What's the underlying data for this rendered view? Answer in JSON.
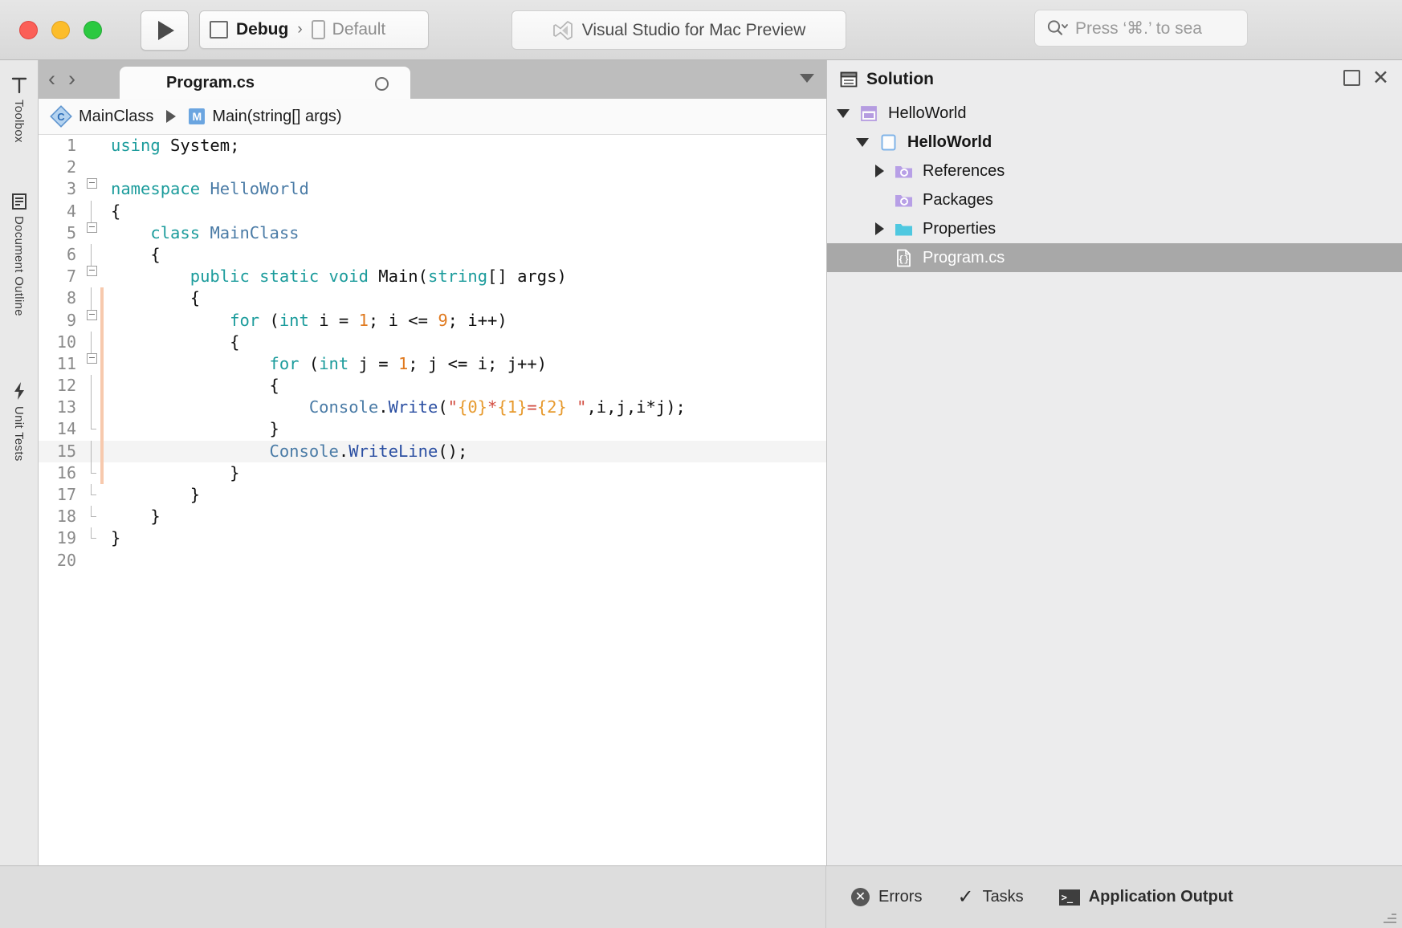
{
  "titlebar": {
    "window_controls": [
      "close",
      "minimize",
      "zoom"
    ],
    "run_button_icon": "play-icon",
    "configuration": "Debug",
    "config_separator": "›",
    "run_target": "Default",
    "app_title": "Visual Studio for Mac Preview",
    "app_logo_icon": "visual-studio-logo-icon",
    "search_placeholder": "Press ‘⌘.’ to sea"
  },
  "left_rail": {
    "items": [
      {
        "label": "Toolbox",
        "icon": "toolbox-icon"
      },
      {
        "label": "Document Outline",
        "icon": "document-outline-icon"
      },
      {
        "label": "Unit Tests",
        "icon": "unit-tests-icon"
      }
    ]
  },
  "editor": {
    "back_arrow": "‹",
    "forward_arrow": "›",
    "tab_title": "Program.cs",
    "breadcrumb": {
      "class_icon": "class-icon",
      "class_name": "MainClass",
      "method_icon_letter": "M",
      "method_name": "Main(string[] args)"
    },
    "total_lines": 20,
    "current_line": 15,
    "lines": [
      {
        "n": 1,
        "fold": "none",
        "change": false,
        "tokens": [
          {
            "c": "k",
            "t": "using"
          },
          {
            "c": "n",
            "t": " System;"
          }
        ]
      },
      {
        "n": 2,
        "fold": "none",
        "change": false,
        "tokens": []
      },
      {
        "n": 3,
        "fold": "open",
        "change": false,
        "tokens": [
          {
            "c": "k",
            "t": "namespace"
          },
          {
            "c": "n",
            "t": " "
          },
          {
            "c": "t",
            "t": "HelloWorld"
          }
        ]
      },
      {
        "n": 4,
        "fold": "line",
        "change": false,
        "tokens": [
          {
            "c": "n",
            "t": "{"
          }
        ]
      },
      {
        "n": 5,
        "fold": "open",
        "change": false,
        "tokens": [
          {
            "c": "n",
            "t": "    "
          },
          {
            "c": "k",
            "t": "class"
          },
          {
            "c": "n",
            "t": " "
          },
          {
            "c": "t",
            "t": "MainClass"
          }
        ]
      },
      {
        "n": 6,
        "fold": "line",
        "change": false,
        "tokens": [
          {
            "c": "n",
            "t": "    {"
          }
        ]
      },
      {
        "n": 7,
        "fold": "open",
        "change": false,
        "tokens": [
          {
            "c": "n",
            "t": "        "
          },
          {
            "c": "k",
            "t": "public static void"
          },
          {
            "c": "n",
            "t": " Main("
          },
          {
            "c": "k",
            "t": "string"
          },
          {
            "c": "n",
            "t": "[] args)"
          }
        ]
      },
      {
        "n": 8,
        "fold": "line",
        "change": true,
        "tokens": [
          {
            "c": "n",
            "t": "        {"
          }
        ]
      },
      {
        "n": 9,
        "fold": "open",
        "change": true,
        "tokens": [
          {
            "c": "n",
            "t": "            "
          },
          {
            "c": "k",
            "t": "for"
          },
          {
            "c": "n",
            "t": " ("
          },
          {
            "c": "k",
            "t": "int"
          },
          {
            "c": "n",
            "t": " i = "
          },
          {
            "c": "num",
            "t": "1"
          },
          {
            "c": "n",
            "t": "; i <= "
          },
          {
            "c": "num",
            "t": "9"
          },
          {
            "c": "n",
            "t": "; i++)"
          }
        ]
      },
      {
        "n": 10,
        "fold": "line",
        "change": true,
        "tokens": [
          {
            "c": "n",
            "t": "            {"
          }
        ]
      },
      {
        "n": 11,
        "fold": "open",
        "change": true,
        "tokens": [
          {
            "c": "n",
            "t": "                "
          },
          {
            "c": "k",
            "t": "for"
          },
          {
            "c": "n",
            "t": " ("
          },
          {
            "c": "k",
            "t": "int"
          },
          {
            "c": "n",
            "t": " j = "
          },
          {
            "c": "num",
            "t": "1"
          },
          {
            "c": "n",
            "t": "; j <= i; j++)"
          }
        ]
      },
      {
        "n": 12,
        "fold": "line",
        "change": true,
        "tokens": [
          {
            "c": "n",
            "t": "                {"
          }
        ]
      },
      {
        "n": 13,
        "fold": "line",
        "change": true,
        "tokens": [
          {
            "c": "n",
            "t": "                    "
          },
          {
            "c": "t",
            "t": "Console"
          },
          {
            "c": "n",
            "t": "."
          },
          {
            "c": "mth",
            "t": "Write"
          },
          {
            "c": "n",
            "t": "("
          },
          {
            "c": "str",
            "t": "\""
          },
          {
            "c": "fmt",
            "t": "{0}"
          },
          {
            "c": "str",
            "t": "*"
          },
          {
            "c": "fmt",
            "t": "{1}"
          },
          {
            "c": "str",
            "t": "="
          },
          {
            "c": "fmt",
            "t": "{2}"
          },
          {
            "c": "str",
            "t": " \""
          },
          {
            "c": "n",
            "t": ",i,j,i*j);"
          }
        ]
      },
      {
        "n": 14,
        "fold": "close",
        "change": true,
        "tokens": [
          {
            "c": "n",
            "t": "                }"
          }
        ]
      },
      {
        "n": 15,
        "fold": "line",
        "change": true,
        "tokens": [
          {
            "c": "n",
            "t": "                "
          },
          {
            "c": "t",
            "t": "Console"
          },
          {
            "c": "n",
            "t": "."
          },
          {
            "c": "mth",
            "t": "WriteLine"
          },
          {
            "c": "n",
            "t": "();"
          }
        ]
      },
      {
        "n": 16,
        "fold": "close",
        "change": true,
        "tokens": [
          {
            "c": "n",
            "t": "            }"
          }
        ]
      },
      {
        "n": 17,
        "fold": "close",
        "change": false,
        "tokens": [
          {
            "c": "n",
            "t": "        }"
          }
        ]
      },
      {
        "n": 18,
        "fold": "close",
        "change": false,
        "tokens": [
          {
            "c": "n",
            "t": "    }"
          }
        ]
      },
      {
        "n": 19,
        "fold": "close",
        "change": false,
        "tokens": [
          {
            "c": "n",
            "t": "}"
          }
        ]
      },
      {
        "n": 20,
        "fold": "none",
        "change": false,
        "tokens": []
      }
    ]
  },
  "solution_pad": {
    "title": "Solution",
    "title_icon": "solution-icon",
    "minimize_icon": "pad-minimize-icon",
    "close_icon": "pad-close-icon",
    "tree": [
      {
        "label": "HelloWorld",
        "icon": "solution-node-icon",
        "indent": 0,
        "twisty": "down",
        "bold": false,
        "selected": false
      },
      {
        "label": "HelloWorld",
        "icon": "project-icon",
        "indent": 1,
        "twisty": "down",
        "bold": true,
        "selected": false
      },
      {
        "label": "References",
        "icon": "references-folder-icon",
        "indent": 2,
        "twisty": "right",
        "bold": false,
        "selected": false
      },
      {
        "label": "Packages",
        "icon": "packages-folder-icon",
        "indent": 2,
        "twisty": "none",
        "bold": false,
        "selected": false
      },
      {
        "label": "Properties",
        "icon": "folder-icon",
        "indent": 2,
        "twisty": "right",
        "bold": false,
        "selected": false
      },
      {
        "label": "Program.cs",
        "icon": "csharp-file-icon",
        "indent": 2,
        "twisty": "none",
        "bold": false,
        "selected": true
      }
    ]
  },
  "statusbar": {
    "items": [
      {
        "label": "Errors",
        "icon": "error-icon",
        "bold": false
      },
      {
        "label": "Tasks",
        "icon": "check-icon",
        "bold": false
      },
      {
        "label": "Application Output",
        "icon": "terminal-icon",
        "bold": true
      }
    ]
  },
  "colors": {
    "keyword": "#1c9c9c",
    "type": "#4a7ba6",
    "number": "#e07a20",
    "string": "#d24b3f",
    "format_placeholder": "#e79a2e",
    "method": "#2b4fa2",
    "selection": "#a8a8a8",
    "modified_gutter": "#f7c9ad",
    "marker_dot": "#f2c12e"
  }
}
